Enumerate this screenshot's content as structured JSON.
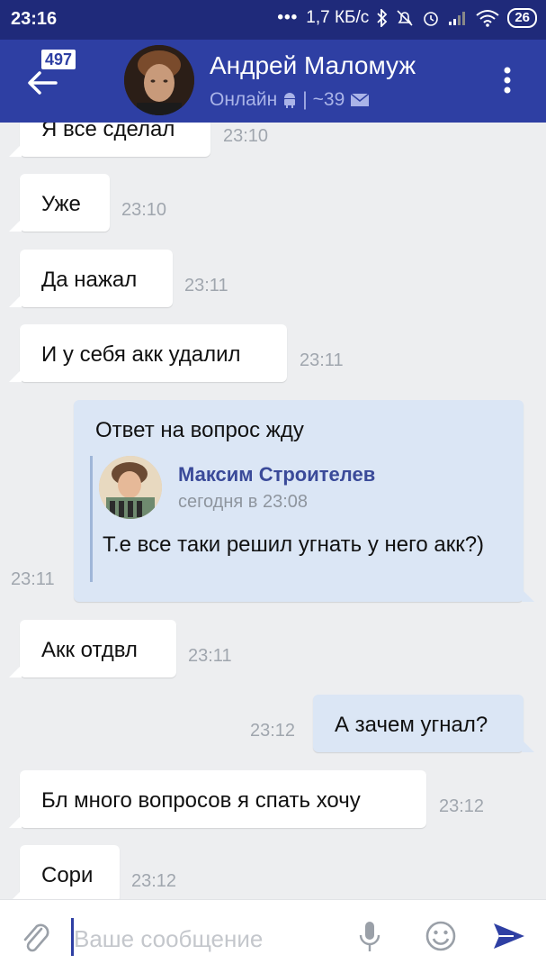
{
  "status_bar": {
    "time": "23:16",
    "dots": "•••",
    "network_speed": "1,7 КБ/с",
    "battery": "26"
  },
  "header": {
    "unread_badge": "497",
    "contact_name": "Андрей Маломуж",
    "status_online": "Онлайн",
    "status_separator": "|",
    "status_count": "~39"
  },
  "messages": [
    {
      "direction": "in",
      "text": "Я все сделал",
      "time": "23:10"
    },
    {
      "direction": "in",
      "text": "Уже",
      "time": "23:10"
    },
    {
      "direction": "in",
      "text": "Да нажал",
      "time": "23:11"
    },
    {
      "direction": "in",
      "text": "И у себя акк удалил",
      "time": "23:11"
    },
    {
      "direction": "out",
      "text": "Ответ на вопрос жду",
      "time": "23:11",
      "forwarded": {
        "author": "Максим Строителев",
        "date": "сегодня в 23:08",
        "text": "Т.е все таки решил угнать у него акк?)"
      }
    },
    {
      "direction": "in",
      "text": "Акк отдвл",
      "time": "23:11"
    },
    {
      "direction": "out",
      "text": "А зачем угнал?",
      "time": "23:12"
    },
    {
      "direction": "in",
      "text": "Бл много вопросов я спать хочу",
      "time": "23:12"
    },
    {
      "direction": "in",
      "text": "Сори",
      "time": "23:12"
    }
  ],
  "composer": {
    "placeholder": "Ваше сообщение",
    "icons": [
      "paperclip-icon",
      "microphone-icon",
      "smiley-icon",
      "send-icon"
    ]
  },
  "colors": {
    "status_bar": "#1f2a7a",
    "app_bar": "#2e3fa3",
    "chat_bg": "#edeef0",
    "incoming_bubble": "#ffffff",
    "outgoing_bubble": "#dbe6f5",
    "link_name": "#3a4a99"
  }
}
